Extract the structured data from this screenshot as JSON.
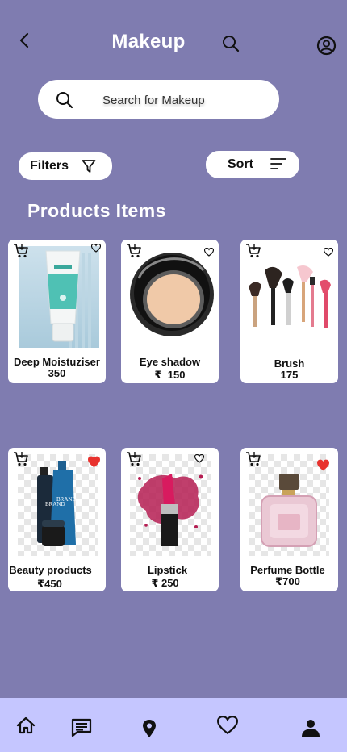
{
  "header": {
    "title": "Makeup",
    "icons": [
      "back-arrow-icon",
      "search-icon",
      "profile-icon"
    ]
  },
  "search": {
    "placeholder": "Search for Makeup"
  },
  "toolbar": {
    "filters_label": "Filters",
    "sort_label": "Sort"
  },
  "section": {
    "title": "Products Items"
  },
  "products": [
    {
      "name": "Deep Moistuziser",
      "price": "350",
      "favorite": false
    },
    {
      "name": "Eye shadow",
      "price": "₹  150",
      "favorite": false
    },
    {
      "name": "Brush",
      "price": "175",
      "favorite": false
    },
    {
      "name": "Beauty products",
      "price": "₹450",
      "favorite": true
    },
    {
      "name": "Lipstick",
      "price": "₹ 250",
      "favorite": false
    },
    {
      "name": "Perfume Bottle",
      "price": "₹700",
      "favorite": true
    }
  ],
  "bottom_nav": {
    "items": [
      "home-icon",
      "chat-icon",
      "location-icon",
      "heart-icon",
      "person-icon"
    ]
  },
  "colors": {
    "background": "#7f7cb0",
    "bottom_nav": "#c5c6ff",
    "favorite": "#e8322e"
  }
}
